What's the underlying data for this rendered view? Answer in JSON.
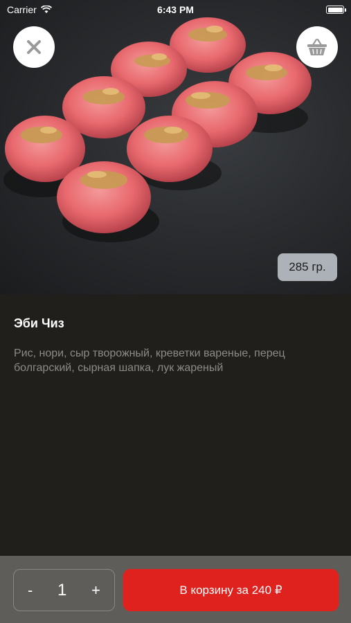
{
  "status_bar": {
    "carrier": "Carrier",
    "time": "6:43 PM"
  },
  "product": {
    "name": "Эби Чиз",
    "description": "Рис, нори, сыр творожный, креветки вареные, перец болгарский, сырная шапка, лук жареный",
    "weight": "285 гр."
  },
  "cart": {
    "minus_label": "-",
    "quantity": "1",
    "plus_label": "+",
    "add_button_label": "В корзину за 240 ₽"
  },
  "icons": {
    "close": "close-icon",
    "basket": "basket-icon",
    "wifi": "wifi-icon",
    "battery": "battery-icon"
  },
  "colors": {
    "accent": "#e0221f",
    "background": "#201f1c",
    "bottom_bar": "#5f5d59",
    "description": "#8d8b86"
  }
}
